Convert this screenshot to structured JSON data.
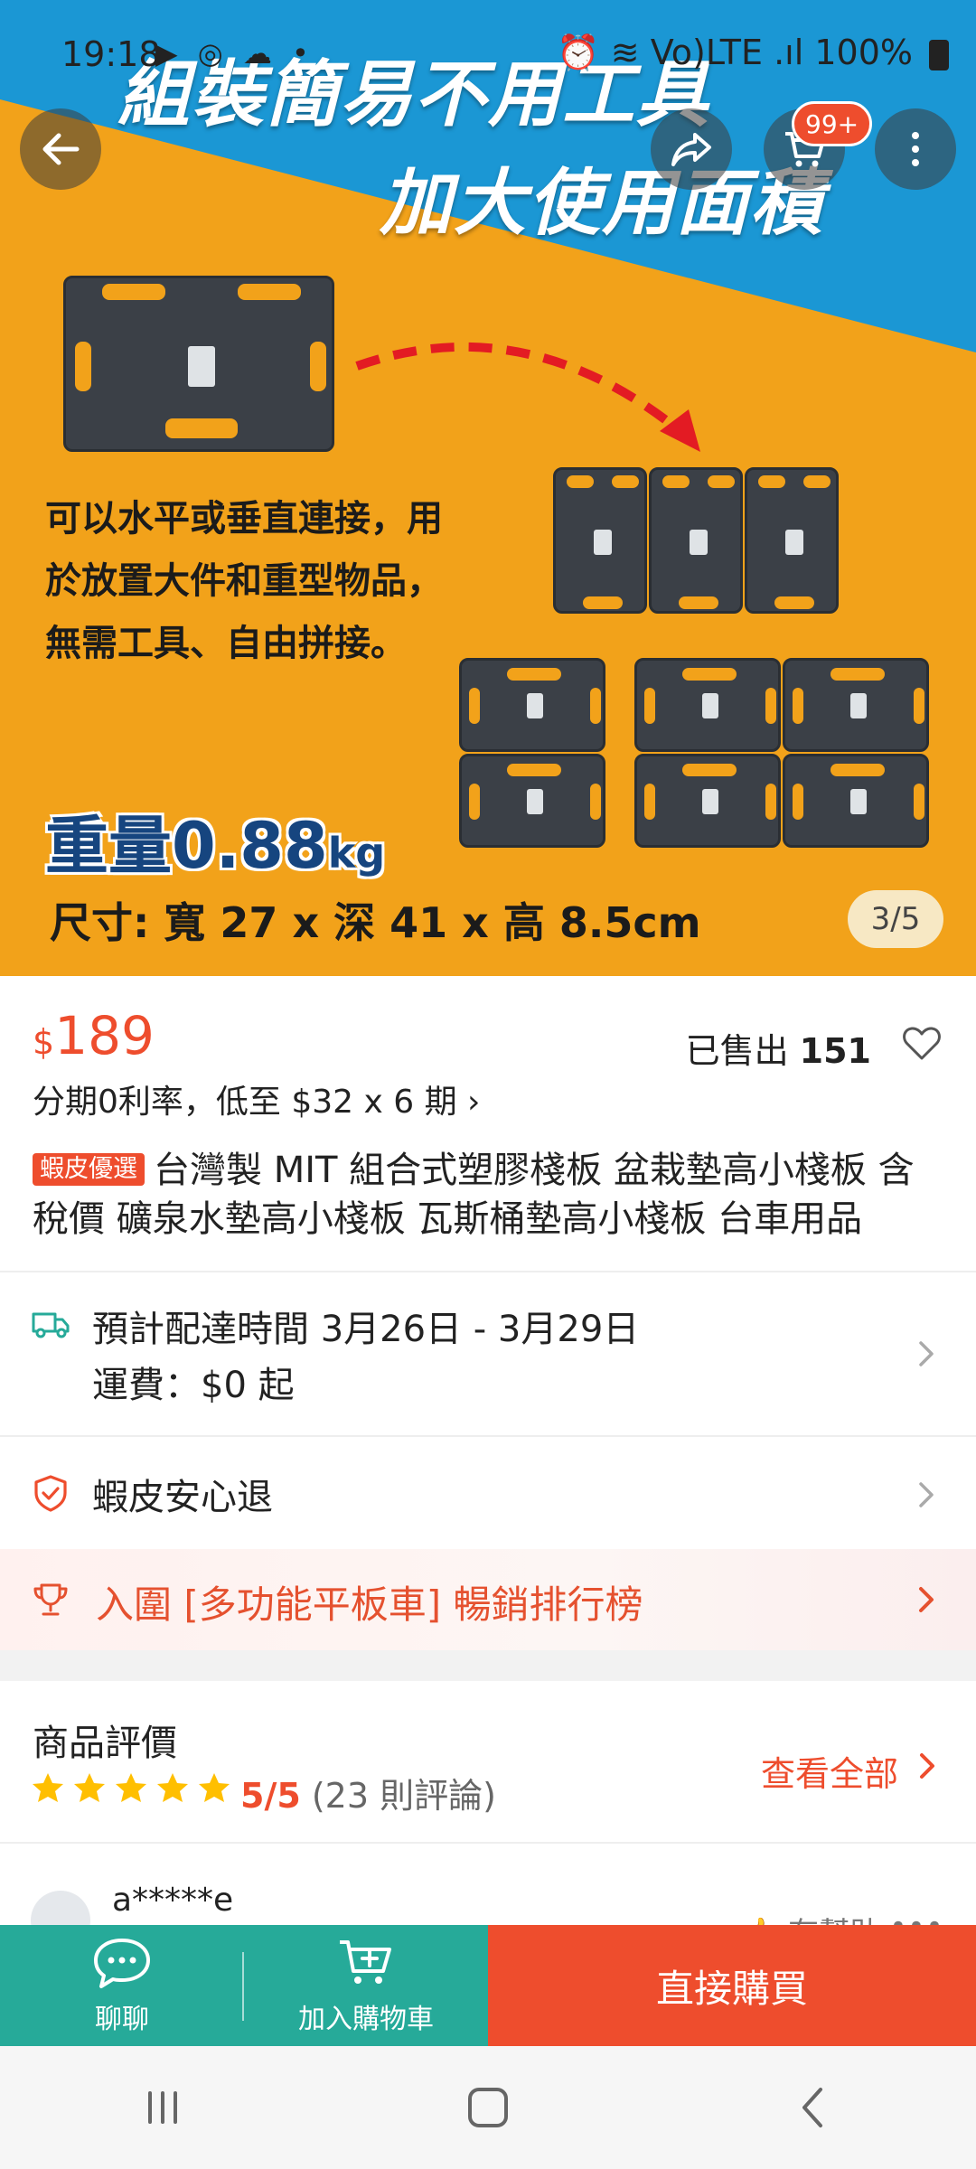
{
  "status_bar": {
    "time": "19:18",
    "icons_left": "▶ ◎ ☁ •",
    "icons_right": "⏰ ≋ Vo)LTE .ıl 100%"
  },
  "hero": {
    "headline_1": "組裝簡易不用工具",
    "headline_2": "加大使用面積",
    "description": "可以水平或垂直連接，用於放置大件和重型物品，無需工具、自由拼接。",
    "weight_label": "重量",
    "weight_value": "0.88",
    "weight_unit": "kg",
    "dimensions": "尺寸: 寬 27 x 深 41 x 高 8.5cm",
    "counter": "3/5"
  },
  "top_actions": {
    "cart_badge": "99+"
  },
  "product": {
    "currency": "$",
    "price": "189",
    "sold_label": "已售出",
    "sold_count": "151",
    "installment": "分期0利率，低至 $32 x 6 期 ›",
    "tag": "蝦皮優選",
    "title": "台灣製 MIT 組合式塑膠棧板 盆栽墊高小棧板 含稅價   礦泉水墊高小棧板 瓦斯桶墊高小棧板  台車用品"
  },
  "delivery": {
    "line1": "預計配達時間 3月26日 - 3月29日",
    "line2": "運費：$0 起"
  },
  "guarantee": {
    "label": "蝦皮安心退"
  },
  "ranking": {
    "label": "入圍 [多功能平板車] 暢銷排行榜"
  },
  "reviews": {
    "title": "商品評價",
    "stars": 5,
    "score": "5/5",
    "count": "(23 則評論)",
    "see_all": "查看全部",
    "first_reviewer": "a*****e",
    "helpful": "有幫助"
  },
  "action_bar": {
    "chat_label": "聊聊",
    "add_cart_label": "加入購物車",
    "buy_label": "直接購買"
  },
  "colors": {
    "brand": "#ee4d2d",
    "teal": "#26aa99",
    "hero_blue": "#1b97d4",
    "hero_orange": "#f2a21a"
  }
}
